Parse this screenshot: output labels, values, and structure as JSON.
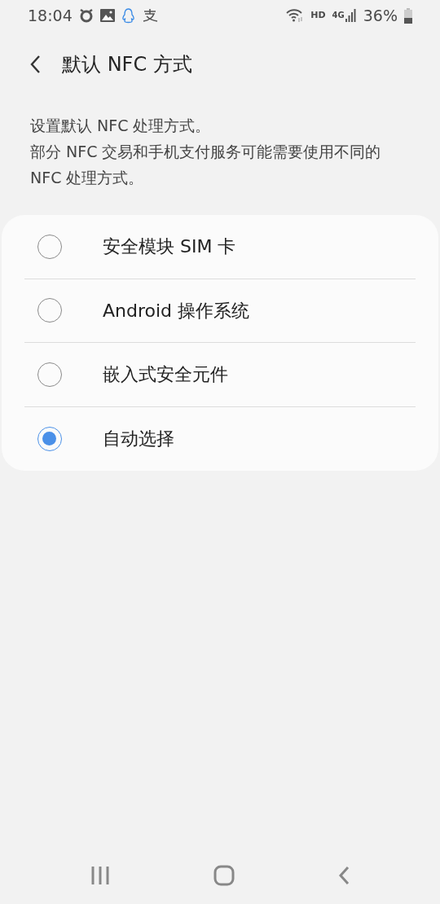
{
  "status_bar": {
    "time": "18:04",
    "network_hd": "HD",
    "network_type": "4G",
    "battery": "36%"
  },
  "header": {
    "title": "默认 NFC 方式"
  },
  "description": [
    "设置默认 NFC 处理方式。",
    "部分 NFC 交易和手机支付服务可能需要使用不同的 NFC 处理方式。"
  ],
  "options": [
    {
      "label": "安全模块 SIM 卡",
      "selected": false
    },
    {
      "label": "Android 操作系统",
      "selected": false
    },
    {
      "label": "嵌入式安全元件",
      "selected": false
    },
    {
      "label": "自动选择",
      "selected": true
    }
  ]
}
